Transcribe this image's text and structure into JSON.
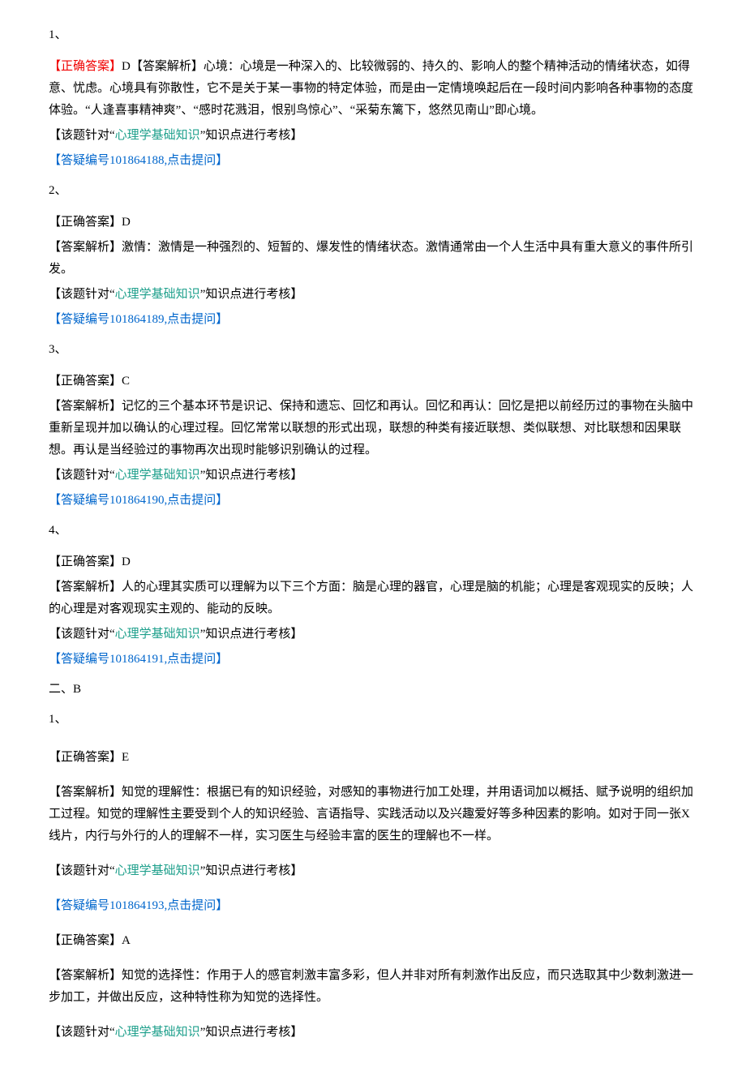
{
  "q1": {
    "num": "1、",
    "answer_prefix": "【正确答案】",
    "answer_letter": "D",
    "explanation_prefix": "【答案解析】",
    "explanation_body": "心境：心境是一种深入的、比较微弱的、持久的、影响人的整个精神活动的情绪状态，如得意、忧虑。心境具有弥散性，它不是关于某一事物的特定体验，而是由一定情境唤起后在一段时间内影响各种事物的态度体验。“人逢喜事精神爽”、“感时花溅泪，恨别鸟惊心”、“采菊东篱下，悠然见南山”即心境。",
    "topic_prefix": "【该题针对“",
    "topic_name": "心理学基础知识",
    "topic_suffix": "”知识点进行考核】",
    "link": "【答疑编号101864188,点击提问】"
  },
  "q2": {
    "num": "2、",
    "answer_prefix": "【正确答案】D",
    "explanation": "【答案解析】激情：激情是一种强烈的、短暂的、爆发性的情绪状态。激情通常由一个人生活中具有重大意义的事件所引发。",
    "topic_prefix": "【该题针对“",
    "topic_name": "心理学基础知识",
    "topic_suffix": "”知识点进行考核】",
    "link": "【答疑编号101864189,点击提问】"
  },
  "q3": {
    "num": "3、",
    "answer_prefix": "【正确答案】C",
    "explanation": "【答案解析】记忆的三个基本环节是识记、保持和遗忘、回忆和再认。回忆和再认：回忆是把以前经历过的事物在头脑中重新呈现并加以确认的心理过程。回忆常常以联想的形式出现，联想的种类有接近联想、类似联想、对比联想和因果联想。再认是当经验过的事物再次出现时能够识别确认的过程。",
    "topic_prefix": "【该题针对“",
    "topic_name": "心理学基础知识",
    "topic_suffix": "”知识点进行考核】",
    "link": "【答疑编号101864190,点击提问】"
  },
  "q4": {
    "num": "4、",
    "answer_prefix": "【正确答案】D",
    "explanation": "【答案解析】人的心理其实质可以理解为以下三个方面：脑是心理的器官，心理是脑的机能；心理是客观现实的反映；人的心理是对客观现实主观的、能动的反映。",
    "topic_prefix": "【该题针对“",
    "topic_name": "心理学基础知识",
    "topic_suffix": "”知识点进行考核】",
    "link": "【答疑编号101864191,点击提问】"
  },
  "section2": {
    "header": "二、B",
    "q1num": "1、"
  },
  "b1": {
    "answer_prefix": "【正确答案】E",
    "explanation": "【答案解析】知觉的理解性：根据已有的知识经验，对感知的事物进行加工处理，并用语词加以概括、赋予说明的组织加工过程。知觉的理解性主要受到个人的知识经验、言语指导、实践活动以及兴趣爱好等多种因素的影响。如对于同一张X线片，内行与外行的人的理解不一样，实习医生与经验丰富的医生的理解也不一样。",
    "topic_prefix": "【该题针对“",
    "topic_name": "心理学基础知识",
    "topic_suffix": "”知识点进行考核】",
    "link": "【答疑编号101864193,点击提问】"
  },
  "b2": {
    "answer_prefix": "【正确答案】A",
    "explanation": "【答案解析】知觉的选择性：作用于人的感官刺激丰富多彩，但人并非对所有刺激作出反应，而只选取其中少数刺激进一步加工，并做出反应，这种特性称为知觉的选择性。",
    "topic_prefix": "【该题针对“",
    "topic_name": "心理学基础知识",
    "topic_suffix": "”知识点进行考核】"
  }
}
